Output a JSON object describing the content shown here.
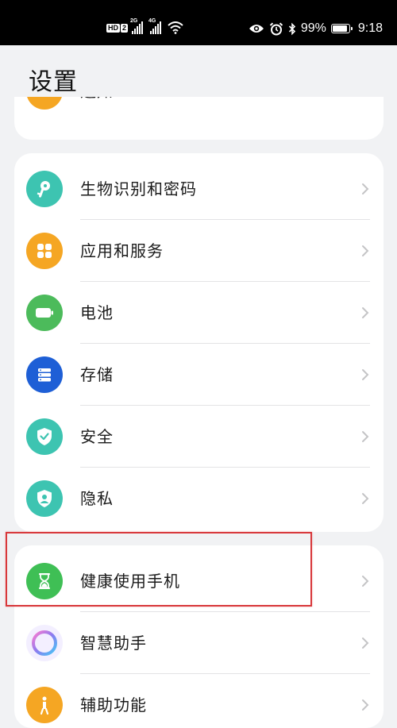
{
  "status_bar": {
    "network_hd": "HD",
    "network_hd_sim": "2",
    "sim1_type": "2G",
    "sim2_type": "4G",
    "battery_percent": "99%",
    "battery_level": 0.99,
    "time": "9:18",
    "icons": [
      "wifi-icon",
      "eye-icon",
      "alarm-icon",
      "bluetooth-icon",
      "battery-icon"
    ]
  },
  "page": {
    "title": "设置"
  },
  "colors": {
    "notify": "#f5a623",
    "biometrics": "#3dc4b1",
    "apps": "#f5a623",
    "battery": "#4cbb5b",
    "storage": "#1e5fd6",
    "security": "#3dc4b1",
    "privacy": "#3dc4b1",
    "digital_balance": "#3fbf55",
    "assistant": "#8a7cf0",
    "accessibility": "#f5a623",
    "highlight": "#d8383b"
  },
  "sections": {
    "top_partial": {
      "label": "通知",
      "icon": "bell-icon"
    },
    "group_a": [
      {
        "label": "生物识别和密码",
        "icon": "key-icon"
      },
      {
        "label": "应用和服务",
        "icon": "apps-grid-icon"
      },
      {
        "label": "电池",
        "icon": "battery-icon"
      },
      {
        "label": "存储",
        "icon": "storage-icon"
      },
      {
        "label": "安全",
        "icon": "shield-icon"
      },
      {
        "label": "隐私",
        "icon": "privacy-icon"
      }
    ],
    "group_b": [
      {
        "label": "健康使用手机",
        "icon": "hourglass-icon"
      },
      {
        "label": "智慧助手",
        "icon": "assistant-ring-icon"
      },
      {
        "label": "辅助功能",
        "icon": "accessibility-icon"
      }
    ]
  }
}
